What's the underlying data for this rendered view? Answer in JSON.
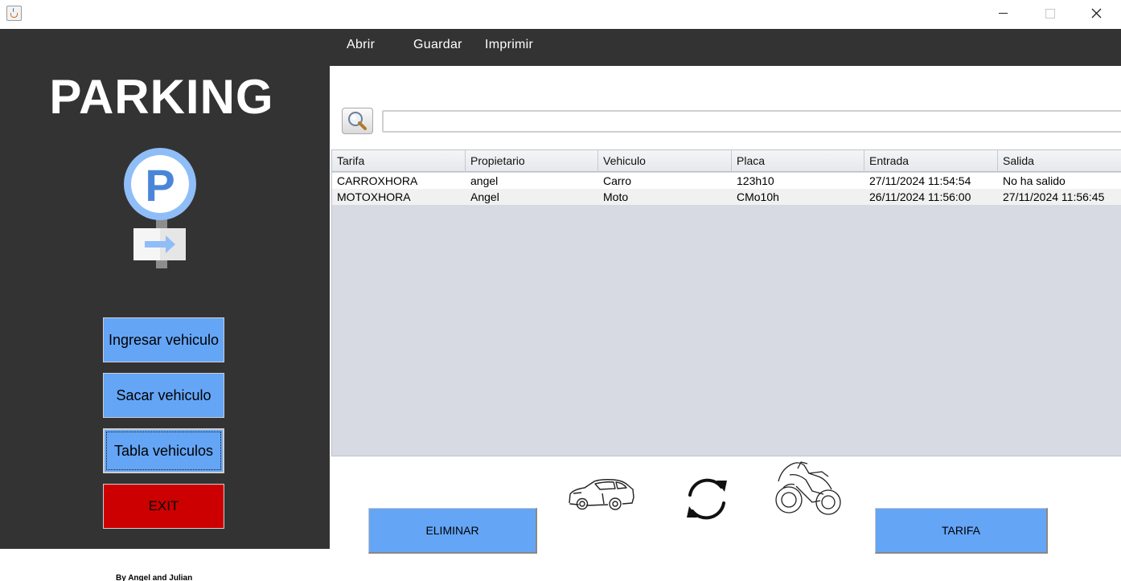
{
  "menu": {
    "items": [
      "Abrir",
      "Guardar",
      "Imprimir"
    ]
  },
  "sidebar": {
    "title": "PARKING",
    "buttons": {
      "ingresar": "Ingresar vehiculo",
      "sacar": "Sacar vehiculo",
      "tabla": "Tabla vehiculos",
      "exit": "EXIT"
    },
    "credit": "By Angel and Julian"
  },
  "search": {
    "value": "",
    "placeholder": ""
  },
  "table": {
    "columns": [
      "Tarifa",
      "Propietario",
      "Vehiculo",
      "Placa",
      "Entrada",
      "Salida"
    ],
    "rows": [
      [
        "CARROXHORA",
        "angel",
        "Carro",
        "123h10",
        "27/11/2024 11:54:54",
        "No ha salido"
      ],
      [
        "MOTOXHORA",
        "Angel",
        "Moto",
        "CMo10h",
        "26/11/2024 11:56:00",
        "27/11/2024 11:56:45"
      ]
    ]
  },
  "actions": {
    "eliminar": "ELIMINAR",
    "tarifa": "TARIFA"
  },
  "colors": {
    "sidebar_bg": "#333333",
    "button_blue": "#64a5f6",
    "exit_red": "#cc0000",
    "table_bg": "#d7dae2"
  },
  "icons": [
    "java-app-icon",
    "parking-sign-icon",
    "search-icon",
    "car-icon",
    "refresh-icon",
    "motorcycle-icon"
  ]
}
